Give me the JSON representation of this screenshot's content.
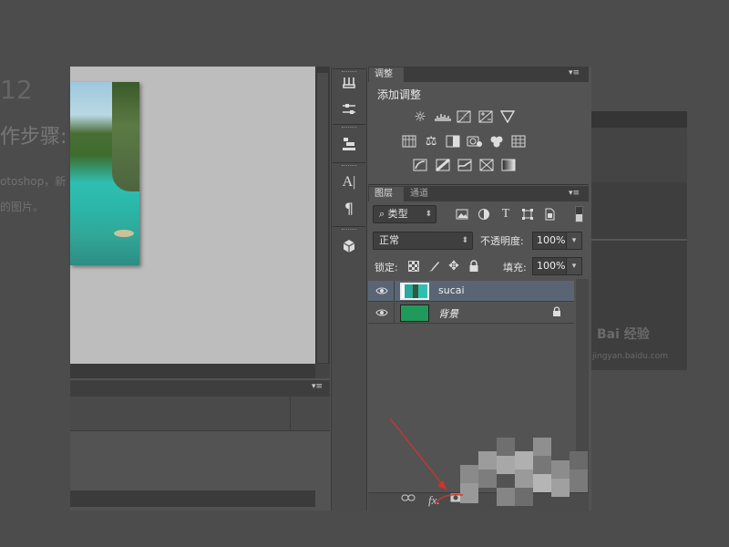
{
  "background_page": {
    "step_number": "12",
    "heading": "作步骤:",
    "line1": "otoshop，新",
    "line2": "的图片。",
    "watermark_brand": "Bai 经验",
    "watermark_url": "jingyan.baidu.com"
  },
  "adjustments": {
    "tab_label": "调整",
    "title": "添加调整",
    "menu_glyph": "▾≡",
    "icons_row1": [
      "brightness-contrast-icon",
      "levels-icon",
      "curves-icon",
      "exposure-icon",
      "vibrance-icon"
    ],
    "icons_row2": [
      "hue-saturation-icon",
      "color-balance-icon",
      "black-white-icon",
      "photo-filter-icon",
      "channel-mixer-icon",
      "color-lookup-icon"
    ],
    "icons_row3": [
      "invert-icon",
      "posterize-icon",
      "threshold-icon",
      "selective-color-icon",
      "gradient-map-icon"
    ]
  },
  "layers": {
    "tab_label": "图层",
    "channels_tab_label": "通道",
    "menu_glyph": "▾≡",
    "filter_kind": "类型",
    "filter_search_glyph": "⌕",
    "blend_mode": "正常",
    "opacity_label": "不透明度:",
    "opacity_value": "100%",
    "lock_label": "锁定:",
    "fill_label": "填充:",
    "fill_value": "100%",
    "items": [
      {
        "name": "sucai",
        "selected": true,
        "thumb_color": "#2aa89d"
      },
      {
        "name": "背景",
        "selected": false,
        "thumb_color": "#2a9a5a",
        "locked": true
      }
    ],
    "bottom_link_glyph": "⊖",
    "bottom_fx": "fx."
  },
  "timeline": {
    "menu_glyph": "▾≡"
  },
  "colors": {
    "panel_bg": "#535353",
    "selected_row": "#596574",
    "annotation_red": "#d0342c"
  }
}
